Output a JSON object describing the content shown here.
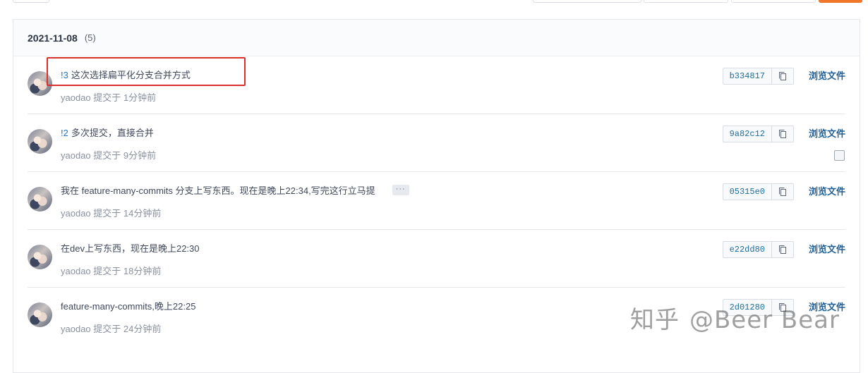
{
  "group": {
    "date": "2021-11-08",
    "count": "(5)"
  },
  "commits": [
    {
      "pr": "!3",
      "message": "这次选择扁平化分支合并方式",
      "author": "yaodao",
      "meta": "提交于 1分钟前",
      "sha": "b334817",
      "browse": "浏览文件",
      "has_more": false,
      "has_checkbox": false
    },
    {
      "pr": "!2",
      "message": "多次提交，直接合并",
      "author": "yaodao",
      "meta": "提交于 9分钟前",
      "sha": "9a82c12",
      "browse": "浏览文件",
      "has_more": false,
      "has_checkbox": true
    },
    {
      "pr": "",
      "message": "我在 feature-many-commits 分支上写东西。现在是晚上22:34,写完这行立马提",
      "author": "yaodao",
      "meta": "提交于 14分钟前",
      "sha": "05315e0",
      "browse": "浏览文件",
      "has_more": true,
      "has_checkbox": false
    },
    {
      "pr": "",
      "message": "在dev上写东西，现在是晚上22:30",
      "author": "yaodao",
      "meta": "提交于 18分钟前",
      "sha": "e22dd80",
      "browse": "浏览文件",
      "has_more": false,
      "has_checkbox": false
    },
    {
      "pr": "",
      "message": "feature-many-commits,晚上22:25",
      "author": "yaodao",
      "meta": "提交于 24分钟前",
      "sha": "2d01280",
      "browse": "浏览文件",
      "has_more": false,
      "has_checkbox": false
    }
  ],
  "more_label": "···",
  "watermark": {
    "brand": "知乎",
    "handle": "@Beer Bear"
  },
  "colors": {
    "accent": "#1f5f96",
    "pr_link": "#1f76c9",
    "highlight": "#d9302b",
    "top_button": "#f0762a"
  }
}
